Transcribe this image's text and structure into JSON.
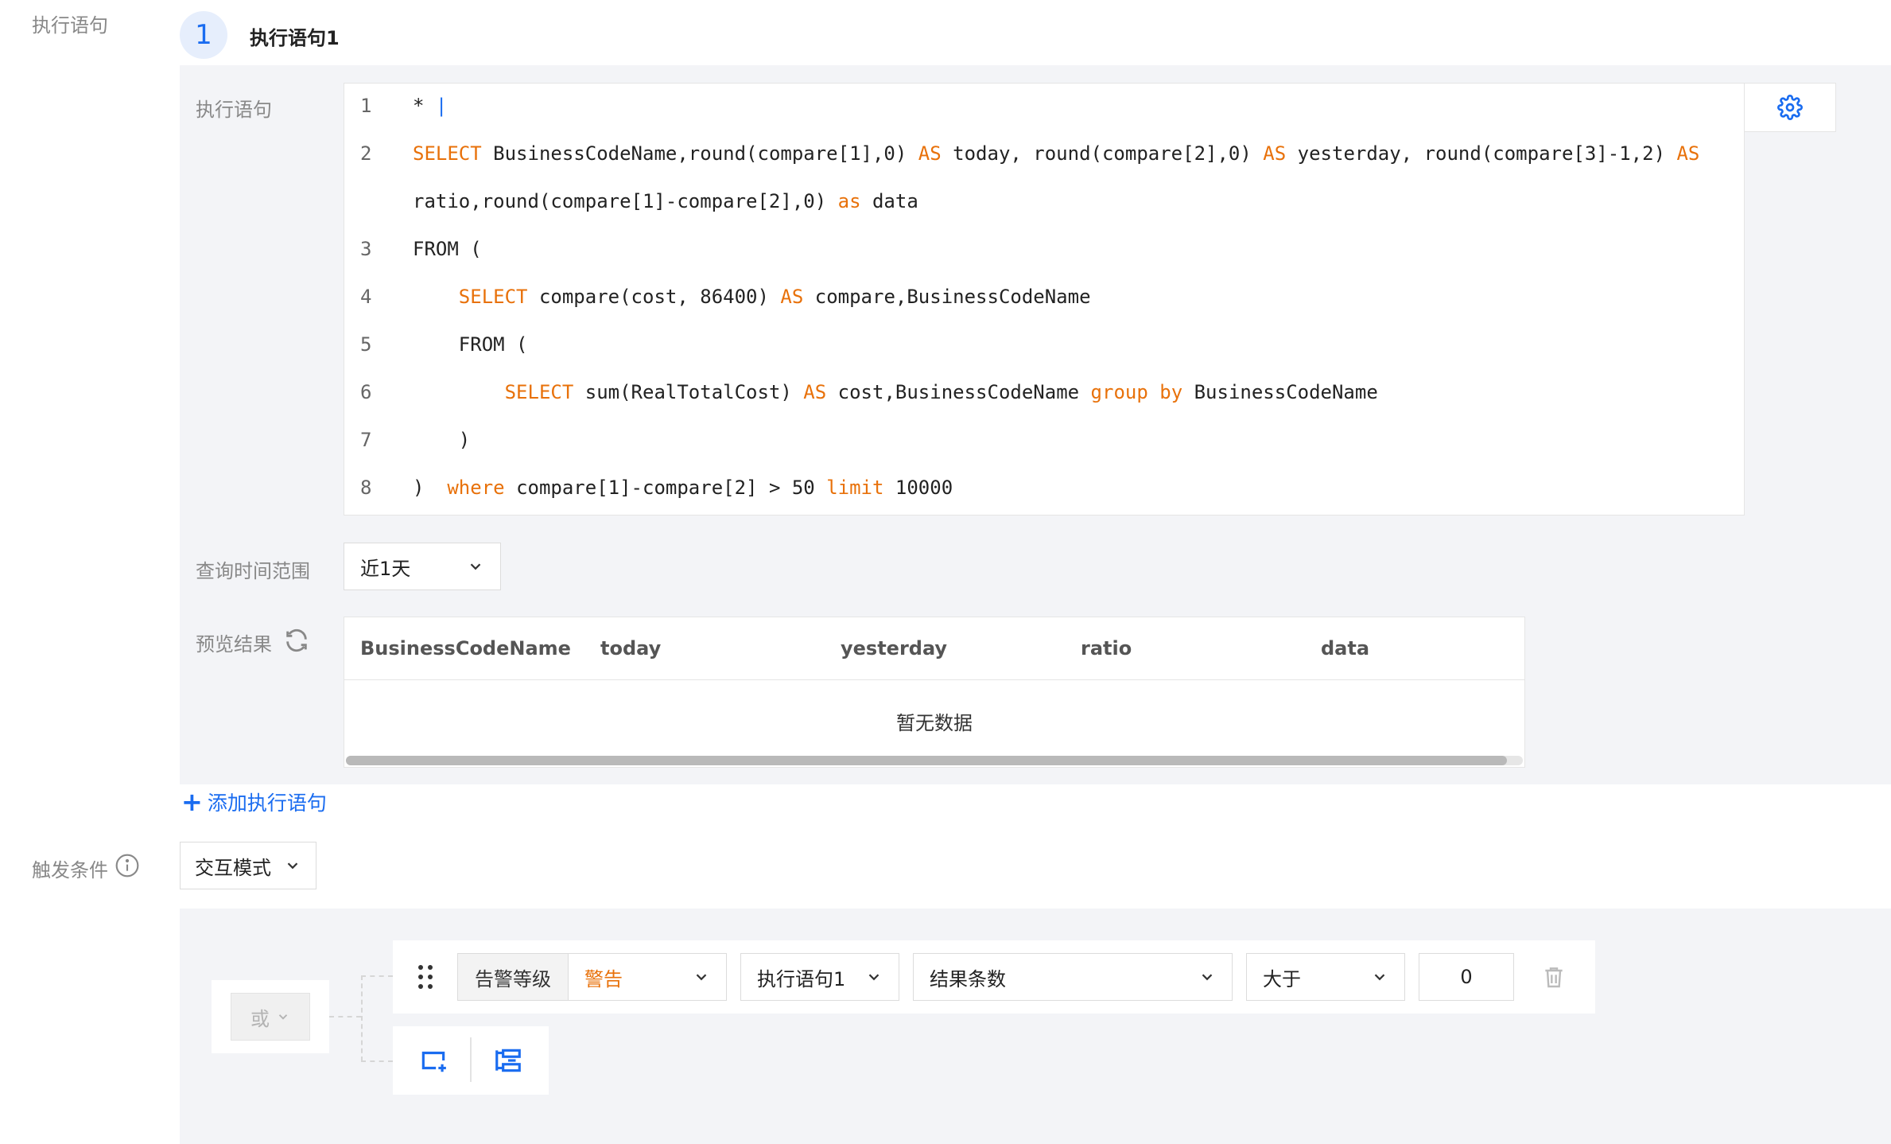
{
  "left_labels": {
    "execute_statement": "执行语句",
    "trigger_condition": "触发条件"
  },
  "step": {
    "number": "1",
    "title": "执行语句1"
  },
  "statement_panel": {
    "label_statement": "执行语句",
    "label_time_range": "查询时间范围",
    "label_preview": "预览结果",
    "add_statement_link": "添加执行语句",
    "time_range_value": "近1天"
  },
  "code": {
    "lines": [
      {
        "num": "1",
        "parts": [
          {
            "t": "* ",
            "k": false
          },
          {
            "t": "|",
            "k": false
          }
        ]
      },
      {
        "num": "2",
        "parts": [
          {
            "t": "SELECT ",
            "k": true
          },
          {
            "t": "BusinessCodeName,round(compare[1],0) ",
            "k": false
          },
          {
            "t": "AS ",
            "k": true
          },
          {
            "t": "today, round(compare[2],0) ",
            "k": false
          },
          {
            "t": "AS ",
            "k": true
          },
          {
            "t": "yesterday, round(compare[3]-1,2) ",
            "k": false
          },
          {
            "t": "AS",
            "k": true
          }
        ]
      },
      {
        "num": "",
        "parts": [
          {
            "t": "ratio,round(compare[1]-compare[2],0) ",
            "k": false
          },
          {
            "t": "as ",
            "k": true
          },
          {
            "t": "data",
            "k": false
          }
        ]
      },
      {
        "num": "3",
        "parts": [
          {
            "t": "FROM (",
            "k": false
          }
        ]
      },
      {
        "num": "4",
        "parts": [
          {
            "t": "    ",
            "k": false
          },
          {
            "t": "SELECT ",
            "k": true
          },
          {
            "t": "compare(cost, 86400) ",
            "k": false
          },
          {
            "t": "AS ",
            "k": true
          },
          {
            "t": "compare,BusinessCodeName",
            "k": false
          }
        ]
      },
      {
        "num": "5",
        "parts": [
          {
            "t": "    FROM (",
            "k": false
          }
        ]
      },
      {
        "num": "6",
        "parts": [
          {
            "t": "        ",
            "k": false
          },
          {
            "t": "SELECT ",
            "k": true
          },
          {
            "t": "sum(RealTotalCost) ",
            "k": false
          },
          {
            "t": "AS ",
            "k": true
          },
          {
            "t": "cost,BusinessCodeName ",
            "k": false
          },
          {
            "t": "group by ",
            "k": true
          },
          {
            "t": "BusinessCodeName",
            "k": false
          }
        ]
      },
      {
        "num": "7",
        "parts": [
          {
            "t": "    )",
            "k": false
          }
        ]
      },
      {
        "num": "8",
        "parts": [
          {
            "t": ")  ",
            "k": false
          },
          {
            "t": "where ",
            "k": true
          },
          {
            "t": "compare[1]-compare[2] > 50 ",
            "k": false
          },
          {
            "t": "limit ",
            "k": true
          },
          {
            "t": "10000",
            "k": false
          }
        ]
      }
    ]
  },
  "preview_table": {
    "columns": [
      "BusinessCodeName",
      "today",
      "yesterday",
      "ratio",
      "data"
    ],
    "empty_text": "暂无数据"
  },
  "trigger": {
    "mode_value": "交互模式",
    "logic_value": "或",
    "condition": {
      "level_label": "告警等级",
      "level_value": "警告",
      "statement_value": "执行语句1",
      "metric_value": "结果条数",
      "operator_value": "大于",
      "threshold_value": "0"
    }
  },
  "colors": {
    "accent_blue": "#1a6cf0",
    "keyword_orange": "#e8710a",
    "warning_orange": "#e8710a"
  }
}
